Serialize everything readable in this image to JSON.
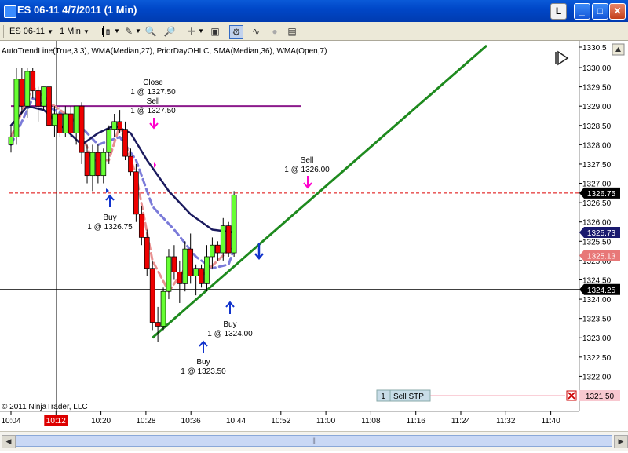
{
  "window": {
    "title": "ES 06-11  4/7/2011 (1 Min)",
    "l_label": "L",
    "min_label": "_",
    "max_label": "□",
    "close_label": "✕"
  },
  "toolbar": {
    "instrument": "ES 06-11",
    "interval": "1 Min"
  },
  "indicator_label": "AutoTrendLine(True,3,3), WMA(Median,27), PriorDayOHLC, SMA(Median,36), WMA(Open,7)",
  "copyright": "© 2011 NinjaTrader, LLC",
  "annotations": [
    {
      "line1": "Close",
      "line2": "1 @ 1327.50",
      "line3": "Sell",
      "line4": "1 @ 1327.50"
    },
    {
      "line1": "Buy",
      "line2": "1 @ 1326.75"
    },
    {
      "line1": "Sell",
      "line2": "1 @ 1326.00"
    },
    {
      "line1": "Buy",
      "line2": "1 @ 1324.00"
    },
    {
      "line1": "Buy",
      "line2": "1 @ 1323.50"
    }
  ],
  "order_badge": {
    "qty": "1",
    "label": "Sell STP",
    "price": "1321.50"
  },
  "price_badges": [
    {
      "label": "1326.75",
      "color": "#000000"
    },
    {
      "label": "1325.73",
      "color": "#1a1a6e"
    },
    {
      "label": "1325.13",
      "color": "#e87878"
    },
    {
      "label": "1324.25",
      "color": "#000000"
    }
  ],
  "chart_data": {
    "type": "candlestick",
    "yaxis_ticks": [
      "1330.5",
      "1330.00",
      "1329.50",
      "1329.00",
      "1328.50",
      "1328.00",
      "1327.50",
      "1327.00",
      "1326.50",
      "1326.00",
      "1325.50",
      "1325.00",
      "1324.50",
      "1324.00",
      "1323.50",
      "1323.00",
      "1322.50",
      "1322.00",
      "1321.50"
    ],
    "xaxis_ticks": [
      "10:04",
      "10:12",
      "10:20",
      "10:28",
      "10:36",
      "10:44",
      "10:52",
      "11:00",
      "11:08",
      "11:16",
      "11:24",
      "11:32",
      "11:40"
    ],
    "highlighted_x_tick": "10:12",
    "ylim": [
      1321.1,
      1330.5
    ],
    "candles": [
      {
        "t": 0,
        "o": 1328.0,
        "h": 1328.5,
        "l": 1327.8,
        "c": 1328.2
      },
      {
        "t": 1,
        "o": 1328.2,
        "h": 1330.0,
        "l": 1328.0,
        "c": 1329.7
      },
      {
        "t": 2,
        "o": 1329.7,
        "h": 1330.0,
        "l": 1328.8,
        "c": 1329.0
      },
      {
        "t": 3,
        "o": 1329.0,
        "h": 1330.0,
        "l": 1328.7,
        "c": 1329.9
      },
      {
        "t": 4,
        "o": 1329.9,
        "h": 1330.0,
        "l": 1329.2,
        "c": 1329.4
      },
      {
        "t": 5,
        "o": 1329.4,
        "h": 1329.5,
        "l": 1328.6,
        "c": 1329.0
      },
      {
        "t": 6,
        "o": 1329.0,
        "h": 1329.5,
        "l": 1328.9,
        "c": 1329.5
      },
      {
        "t": 7,
        "o": 1329.5,
        "h": 1329.6,
        "l": 1328.3,
        "c": 1328.5
      },
      {
        "t": 8,
        "o": 1328.5,
        "h": 1329.0,
        "l": 1328.2,
        "c": 1328.8
      },
      {
        "t": 9,
        "o": 1328.8,
        "h": 1329.0,
        "l": 1328.2,
        "c": 1328.3
      },
      {
        "t": 10,
        "o": 1328.3,
        "h": 1329.0,
        "l": 1328.2,
        "c": 1328.8
      },
      {
        "t": 11,
        "o": 1328.8,
        "h": 1329.0,
        "l": 1328.2,
        "c": 1328.3
      },
      {
        "t": 12,
        "o": 1328.3,
        "h": 1329.0,
        "l": 1328.0,
        "c": 1329.0
      },
      {
        "t": 13,
        "o": 1329.0,
        "h": 1329.1,
        "l": 1327.5,
        "c": 1327.8
      },
      {
        "t": 14,
        "o": 1327.8,
        "h": 1328.0,
        "l": 1327.0,
        "c": 1327.2
      },
      {
        "t": 15,
        "o": 1327.2,
        "h": 1328.0,
        "l": 1326.8,
        "c": 1327.8
      },
      {
        "t": 16,
        "o": 1327.8,
        "h": 1328.0,
        "l": 1327.0,
        "c": 1327.2
      },
      {
        "t": 17,
        "o": 1327.2,
        "h": 1327.9,
        "l": 1327.0,
        "c": 1327.8
      },
      {
        "t": 18,
        "o": 1327.8,
        "h": 1328.5,
        "l": 1327.5,
        "c": 1328.4
      },
      {
        "t": 19,
        "o": 1328.4,
        "h": 1328.8,
        "l": 1328.2,
        "c": 1328.6
      },
      {
        "t": 20,
        "o": 1328.6,
        "h": 1328.9,
        "l": 1328.3,
        "c": 1328.4
      },
      {
        "t": 21,
        "o": 1328.4,
        "h": 1328.6,
        "l": 1327.6,
        "c": 1327.7
      },
      {
        "t": 22,
        "o": 1327.7,
        "h": 1327.9,
        "l": 1327.2,
        "c": 1327.3
      },
      {
        "t": 23,
        "o": 1327.3,
        "h": 1327.5,
        "l": 1326.0,
        "c": 1326.2
      },
      {
        "t": 24,
        "o": 1326.2,
        "h": 1326.4,
        "l": 1325.4,
        "c": 1325.6
      },
      {
        "t": 25,
        "o": 1325.6,
        "h": 1325.8,
        "l": 1324.6,
        "c": 1324.8
      },
      {
        "t": 26,
        "o": 1324.8,
        "h": 1325.0,
        "l": 1323.2,
        "c": 1323.4
      },
      {
        "t": 27,
        "o": 1323.4,
        "h": 1323.8,
        "l": 1322.9,
        "c": 1323.3
      },
      {
        "t": 28,
        "o": 1323.3,
        "h": 1324.3,
        "l": 1323.2,
        "c": 1324.2
      },
      {
        "t": 29,
        "o": 1324.2,
        "h": 1325.3,
        "l": 1324.0,
        "c": 1325.1
      },
      {
        "t": 30,
        "o": 1325.1,
        "h": 1325.4,
        "l": 1324.5,
        "c": 1324.7
      },
      {
        "t": 31,
        "o": 1324.7,
        "h": 1325.0,
        "l": 1323.9,
        "c": 1324.4
      },
      {
        "t": 32,
        "o": 1324.4,
        "h": 1325.5,
        "l": 1324.2,
        "c": 1325.3
      },
      {
        "t": 33,
        "o": 1325.3,
        "h": 1325.7,
        "l": 1324.4,
        "c": 1324.6
      },
      {
        "t": 34,
        "o": 1324.6,
        "h": 1324.9,
        "l": 1324.1,
        "c": 1324.8
      },
      {
        "t": 35,
        "o": 1324.8,
        "h": 1324.9,
        "l": 1324.3,
        "c": 1324.4
      },
      {
        "t": 36,
        "o": 1324.4,
        "h": 1325.4,
        "l": 1324.2,
        "c": 1325.1
      },
      {
        "t": 37,
        "o": 1325.1,
        "h": 1325.6,
        "l": 1324.8,
        "c": 1325.4
      },
      {
        "t": 38,
        "o": 1325.4,
        "h": 1325.5,
        "l": 1325.0,
        "c": 1325.2
      },
      {
        "t": 39,
        "o": 1325.2,
        "h": 1326.1,
        "l": 1325.0,
        "c": 1325.9
      },
      {
        "t": 40,
        "o": 1325.9,
        "h": 1326.0,
        "l": 1325.1,
        "c": 1325.2
      },
      {
        "t": 41,
        "o": 1325.2,
        "h": 1326.8,
        "l": 1325.1,
        "c": 1326.7
      }
    ],
    "horizontal_lines": [
      {
        "price": 1329.0,
        "color": "#8b1a8b",
        "style": "solid"
      },
      {
        "price": 1326.75,
        "color": "#dd0000",
        "style": "dashed"
      },
      {
        "price": 1324.25,
        "color": "#000000",
        "style": "solid"
      }
    ],
    "trendline": {
      "color": "#1e8a1e",
      "from": {
        "t": 26,
        "price": 1323.0
      },
      "to": {
        "t": 82,
        "price": 1331.0
      }
    },
    "wma_median_27": [
      {
        "t": 0,
        "v": 1328.5
      },
      {
        "t": 3,
        "v": 1329.0
      },
      {
        "t": 6,
        "v": 1328.9
      },
      {
        "t": 10,
        "v": 1328.4
      },
      {
        "t": 13,
        "v": 1328.0
      },
      {
        "t": 16,
        "v": 1328.3
      },
      {
        "t": 19,
        "v": 1328.5
      },
      {
        "t": 22,
        "v": 1328.3
      },
      {
        "t": 25,
        "v": 1327.6
      },
      {
        "t": 29,
        "v": 1326.8
      },
      {
        "t": 33,
        "v": 1326.2
      },
      {
        "t": 37,
        "v": 1325.8
      },
      {
        "t": 41,
        "v": 1325.73
      }
    ],
    "sma_median_36": [
      {
        "t": 0,
        "v": 1328.0
      },
      {
        "t": 4,
        "v": 1329.2
      },
      {
        "t": 8,
        "v": 1328.9
      },
      {
        "t": 12,
        "v": 1328.6
      },
      {
        "t": 16,
        "v": 1328.0
      },
      {
        "t": 20,
        "v": 1328.2
      },
      {
        "t": 23,
        "v": 1327.6
      },
      {
        "t": 26,
        "v": 1326.4
      },
      {
        "t": 30,
        "v": 1325.8
      },
      {
        "t": 34,
        "v": 1325.1
      },
      {
        "t": 37,
        "v": 1324.8
      },
      {
        "t": 40,
        "v": 1324.9
      },
      {
        "t": 41,
        "v": 1325.3
      }
    ],
    "wma_open_7": [
      {
        "t": 0,
        "v": 1328.2
      },
      {
        "t": 4,
        "v": 1329.5
      },
      {
        "t": 8,
        "v": 1329.0
      },
      {
        "t": 12,
        "v": 1328.6
      },
      {
        "t": 15,
        "v": 1327.6
      },
      {
        "t": 18,
        "v": 1327.6
      },
      {
        "t": 20,
        "v": 1328.5
      },
      {
        "t": 23,
        "v": 1327.2
      },
      {
        "t": 26,
        "v": 1325.0
      },
      {
        "t": 29,
        "v": 1324.2
      },
      {
        "t": 32,
        "v": 1324.8
      },
      {
        "t": 35,
        "v": 1324.6
      },
      {
        "t": 38,
        "v": 1325.0
      },
      {
        "t": 41,
        "v": 1325.4
      }
    ]
  }
}
